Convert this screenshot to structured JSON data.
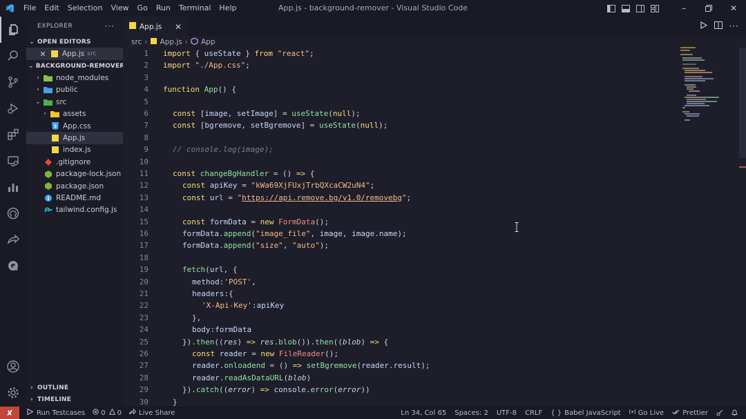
{
  "window": {
    "title": "App.js - background-remover - Visual Studio Code",
    "menu": [
      "File",
      "Edit",
      "Selection",
      "View",
      "Go",
      "Run",
      "Terminal",
      "Help"
    ]
  },
  "sidebar": {
    "title": "EXPLORER",
    "open_editors_label": "OPEN EDITORS",
    "open_editor": {
      "name": "App.js",
      "folder": "src"
    },
    "project_label": "BACKGROUND-REMOVER",
    "tree": [
      {
        "name": "node_modules",
        "kind": "folder",
        "indent": 1,
        "open": false
      },
      {
        "name": "public",
        "kind": "folder",
        "indent": 1,
        "open": false
      },
      {
        "name": "src",
        "kind": "folder",
        "indent": 1,
        "open": true
      },
      {
        "name": "assets",
        "kind": "folder",
        "indent": 2,
        "open": false
      },
      {
        "name": "App.css",
        "kind": "css",
        "indent": 2
      },
      {
        "name": "App.js",
        "kind": "js",
        "indent": 2,
        "selected": true
      },
      {
        "name": "index.js",
        "kind": "js",
        "indent": 2
      },
      {
        "name": ".gitignore",
        "kind": "git",
        "indent": 1
      },
      {
        "name": "package-lock.json",
        "kind": "json",
        "indent": 1
      },
      {
        "name": "package.json",
        "kind": "json",
        "indent": 1
      },
      {
        "name": "README.md",
        "kind": "md",
        "indent": 1
      },
      {
        "name": "tailwind.config.js",
        "kind": "tailwind",
        "indent": 1
      }
    ],
    "outline_label": "OUTLINE",
    "timeline_label": "TIMELINE"
  },
  "editor": {
    "tab": {
      "name": "App.js"
    },
    "breadcrumb": {
      "folder": "src",
      "file": "App.js",
      "symbol": "App"
    },
    "lines": [
      {
        "n": "1",
        "ind": 0,
        "t": [
          [
            "kw",
            "import"
          ],
          [
            "p",
            " { "
          ],
          [
            "var",
            "useState"
          ],
          [
            "p",
            " } "
          ],
          [
            "kw",
            "from"
          ],
          [
            "p",
            " "
          ],
          [
            "str",
            "\"react\""
          ],
          [
            "p",
            ";"
          ]
        ]
      },
      {
        "n": "2",
        "ind": 0,
        "t": [
          [
            "kw",
            "import"
          ],
          [
            "p",
            " "
          ],
          [
            "str",
            "\"./App.css\""
          ],
          [
            "p",
            ";"
          ]
        ]
      },
      {
        "n": "3",
        "ind": 0,
        "t": []
      },
      {
        "n": "4",
        "ind": 0,
        "t": [
          [
            "kw",
            "function"
          ],
          [
            "p",
            " "
          ],
          [
            "fn",
            "App"
          ],
          [
            "p",
            "() {"
          ]
        ]
      },
      {
        "n": "5",
        "ind": 0,
        "t": []
      },
      {
        "n": "6",
        "ind": 1,
        "t": [
          [
            "kw",
            "const"
          ],
          [
            "p",
            " ["
          ],
          [
            "var",
            "image"
          ],
          [
            "p",
            ", "
          ],
          [
            "var",
            "setImage"
          ],
          [
            "p",
            "] = "
          ],
          [
            "fn",
            "useState"
          ],
          [
            "p",
            "("
          ],
          [
            "kw",
            "null"
          ],
          [
            "p",
            ");"
          ]
        ]
      },
      {
        "n": "7",
        "ind": 1,
        "t": [
          [
            "kw",
            "const"
          ],
          [
            "p",
            " ["
          ],
          [
            "var",
            "bgremove"
          ],
          [
            "p",
            ", "
          ],
          [
            "var",
            "setBgremove"
          ],
          [
            "p",
            "] = "
          ],
          [
            "fn",
            "useState"
          ],
          [
            "p",
            "("
          ],
          [
            "kw",
            "null"
          ],
          [
            "p",
            ");"
          ]
        ]
      },
      {
        "n": "8",
        "ind": 0,
        "t": []
      },
      {
        "n": "9",
        "ind": 1,
        "t": [
          [
            "cm",
            "// console.log(image);"
          ]
        ]
      },
      {
        "n": "10",
        "ind": 0,
        "t": []
      },
      {
        "n": "11",
        "ind": 1,
        "t": [
          [
            "kw",
            "const"
          ],
          [
            "p",
            " "
          ],
          [
            "fn",
            "changeBgHandler"
          ],
          [
            "p",
            " = () "
          ],
          [
            "kw",
            "=>"
          ],
          [
            "p",
            " {"
          ]
        ]
      },
      {
        "n": "12",
        "ind": 2,
        "t": [
          [
            "kw",
            "const"
          ],
          [
            "p",
            " "
          ],
          [
            "var",
            "apiKey"
          ],
          [
            "p",
            " = "
          ],
          [
            "str",
            "\"kWa69XjFUxjTrbQXcaCW2uN4\""
          ],
          [
            "p",
            ";"
          ]
        ]
      },
      {
        "n": "13",
        "ind": 2,
        "t": [
          [
            "kw",
            "const"
          ],
          [
            "p",
            " "
          ],
          [
            "var",
            "url"
          ],
          [
            "p",
            " = "
          ],
          [
            "str",
            "\""
          ],
          [
            "lnk",
            "https://api.remove.bg/v1.0/removebg"
          ],
          [
            "str",
            "\""
          ],
          [
            "p",
            ";"
          ]
        ]
      },
      {
        "n": "14",
        "ind": 0,
        "t": []
      },
      {
        "n": "15",
        "ind": 2,
        "t": [
          [
            "kw",
            "const"
          ],
          [
            "p",
            " "
          ],
          [
            "var",
            "formData"
          ],
          [
            "p",
            " = "
          ],
          [
            "kw",
            "new"
          ],
          [
            "p",
            " "
          ],
          [
            "cls",
            "FormData"
          ],
          [
            "p",
            "();"
          ]
        ]
      },
      {
        "n": "16",
        "ind": 2,
        "t": [
          [
            "var",
            "formData"
          ],
          [
            "p",
            "."
          ],
          [
            "fn",
            "append"
          ],
          [
            "p",
            "("
          ],
          [
            "str",
            "\"image_file\""
          ],
          [
            "p",
            ", "
          ],
          [
            "var",
            "image"
          ],
          [
            "p",
            ", "
          ],
          [
            "var",
            "image"
          ],
          [
            "p",
            "."
          ],
          [
            "var",
            "name"
          ],
          [
            "p",
            ");"
          ]
        ]
      },
      {
        "n": "17",
        "ind": 2,
        "t": [
          [
            "var",
            "formData"
          ],
          [
            "p",
            "."
          ],
          [
            "fn",
            "append"
          ],
          [
            "p",
            "("
          ],
          [
            "str",
            "\"size\""
          ],
          [
            "p",
            ", "
          ],
          [
            "str",
            "\"auto\""
          ],
          [
            "p",
            ");"
          ]
        ]
      },
      {
        "n": "18",
        "ind": 0,
        "t": []
      },
      {
        "n": "19",
        "ind": 2,
        "t": [
          [
            "fn",
            "fetch"
          ],
          [
            "p",
            "("
          ],
          [
            "var",
            "url"
          ],
          [
            "p",
            ", {"
          ]
        ]
      },
      {
        "n": "20",
        "ind": 3,
        "t": [
          [
            "var",
            "method"
          ],
          [
            "p",
            ":"
          ],
          [
            "str",
            "'POST'"
          ],
          [
            "p",
            ","
          ]
        ]
      },
      {
        "n": "21",
        "ind": 3,
        "t": [
          [
            "var",
            "headers"
          ],
          [
            "p",
            ":{"
          ]
        ]
      },
      {
        "n": "22",
        "ind": 4,
        "t": [
          [
            "str",
            "'X-Api-Key'"
          ],
          [
            "p",
            ":"
          ],
          [
            "var",
            "apiKey"
          ]
        ]
      },
      {
        "n": "23",
        "ind": 3,
        "t": [
          [
            "p",
            "},"
          ]
        ]
      },
      {
        "n": "24",
        "ind": 3,
        "t": [
          [
            "var",
            "body"
          ],
          [
            "p",
            ":"
          ],
          [
            "var",
            "formData"
          ]
        ]
      },
      {
        "n": "25",
        "ind": 2,
        "t": [
          [
            "p",
            "})."
          ],
          [
            "fn",
            "then"
          ],
          [
            "p",
            "(("
          ],
          [
            "it",
            "res"
          ],
          [
            "p",
            ") "
          ],
          [
            "kw",
            "=>"
          ],
          [
            "p",
            " "
          ],
          [
            "it",
            "res"
          ],
          [
            "p",
            "."
          ],
          [
            "fn",
            "blob"
          ],
          [
            "p",
            "())."
          ],
          [
            "fn",
            "then"
          ],
          [
            "p",
            "(("
          ],
          [
            "it",
            "blob"
          ],
          [
            "p",
            ") "
          ],
          [
            "kw",
            "=>"
          ],
          [
            "p",
            " {"
          ]
        ]
      },
      {
        "n": "26",
        "ind": 3,
        "t": [
          [
            "kw",
            "const"
          ],
          [
            "p",
            " "
          ],
          [
            "var",
            "reader"
          ],
          [
            "p",
            " = "
          ],
          [
            "kw",
            "new"
          ],
          [
            "p",
            " "
          ],
          [
            "cls",
            "FileReader"
          ],
          [
            "p",
            "();"
          ]
        ]
      },
      {
        "n": "27",
        "ind": 3,
        "t": [
          [
            "var",
            "reader"
          ],
          [
            "p",
            "."
          ],
          [
            "fn",
            "onloadend"
          ],
          [
            "p",
            " = () "
          ],
          [
            "kw",
            "=>"
          ],
          [
            "p",
            " "
          ],
          [
            "fn",
            "setBgremove"
          ],
          [
            "p",
            "("
          ],
          [
            "var",
            "reader"
          ],
          [
            "p",
            "."
          ],
          [
            "var",
            "result"
          ],
          [
            "p",
            ");"
          ]
        ]
      },
      {
        "n": "28",
        "ind": 3,
        "t": [
          [
            "var",
            "reader"
          ],
          [
            "p",
            "."
          ],
          [
            "fn",
            "readAsDataURL"
          ],
          [
            "p",
            "("
          ],
          [
            "it",
            "blob"
          ],
          [
            "p",
            ")"
          ]
        ]
      },
      {
        "n": "29",
        "ind": 2,
        "t": [
          [
            "p",
            "})."
          ],
          [
            "fn",
            "catch"
          ],
          [
            "p",
            "(("
          ],
          [
            "it",
            "error"
          ],
          [
            "p",
            ") "
          ],
          [
            "kw",
            "=>"
          ],
          [
            "p",
            " "
          ],
          [
            "var",
            "console"
          ],
          [
            "p",
            "."
          ],
          [
            "fn",
            "error"
          ],
          [
            "p",
            "("
          ],
          [
            "it",
            "error"
          ],
          [
            "p",
            "))"
          ]
        ]
      },
      {
        "n": "30",
        "ind": 1,
        "t": [
          [
            "p",
            "}"
          ]
        ]
      }
    ]
  },
  "statusbar": {
    "run_testcases": "Run Testcases",
    "errors": "0",
    "warnings": "0",
    "live_share": "Live Share",
    "position": "Ln 34, Col 65",
    "spaces": "Spaces: 2",
    "encoding": "UTF-8",
    "eol": "CRLF",
    "language": "Babel JavaScript",
    "go_live": "Go Live",
    "prettier": "Prettier"
  },
  "colors": {
    "background": "#1e1e2a",
    "sidebar": "#1c1c27",
    "accent_remote": "#c2463a",
    "keyword": "#f9d978",
    "function": "#8fe0a0",
    "string": "#f3b88a",
    "class": "#f38b84"
  }
}
